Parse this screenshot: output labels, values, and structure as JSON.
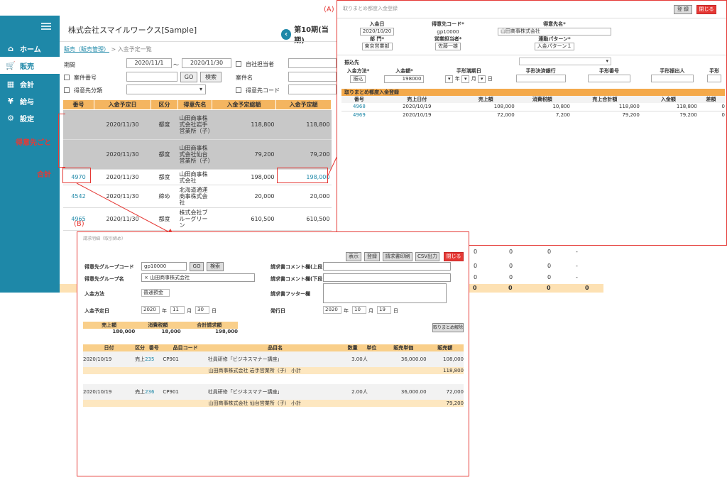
{
  "sidebar": {
    "items": [
      {
        "label": "ホーム"
      },
      {
        "label": "販売"
      },
      {
        "label": "会計"
      },
      {
        "label": "給与"
      },
      {
        "label": "設定"
      }
    ]
  },
  "header": {
    "company": "株式会社スマイルワークス[Sample]",
    "period": "第10期(当期)"
  },
  "breadcrumb": {
    "link": "販売（販売管理）",
    "current": "> 入金予定一覧"
  },
  "filters": {
    "period_label": "期間",
    "from": "2020/11/1",
    "tilde": "～",
    "to": "2020/11/30",
    "own_staff": "自社担当者",
    "case_no": "案件番号",
    "go": "GO",
    "search": "検索",
    "client_name": "案件名",
    "client_class": "得意先分類",
    "client_code": "得意先コード"
  },
  "table": {
    "headers": [
      "番号",
      "入金予定日",
      "区分",
      "得意先名",
      "入金予定総額",
      "入金予定額"
    ],
    "rows": [
      {
        "no": "",
        "date": "2020/11/30",
        "kind": "都度",
        "name": "山田商事株式会社岩手営業所（子）",
        "total": "118,800",
        "amount": "118,800"
      },
      {
        "no": "",
        "date": "2020/11/30",
        "kind": "都度",
        "name": "山田商事株式会社仙台営業所（子）",
        "total": "79,200",
        "amount": "79,200"
      },
      {
        "no": "4970",
        "date": "2020/11/30",
        "kind": "都度",
        "name": "山田商事株式会社",
        "total": "198,000",
        "amount": "198,000"
      },
      {
        "no": "4542",
        "date": "2020/11/30",
        "kind": "締め",
        "name": "北海道通運商事株式会社",
        "total": "20,000",
        "amount": "20,000"
      },
      {
        "no": "4965",
        "date": "2020/11/30",
        "kind": "都度",
        "name": "株式会社ブルーグリーン",
        "total": "610,500",
        "amount": "610,500"
      }
    ]
  },
  "annotations": {
    "per_client": "得意先ごと",
    "total": "合計",
    "A": "(A)",
    "B": "(B)"
  },
  "panelA": {
    "title": "取りまとめ都度入金登録",
    "register": "登 録",
    "close": "閉じる",
    "h1": [
      "入金日",
      "得意先コード*",
      "得意先名*"
    ],
    "v1": [
      "2020/10/20",
      "gp10000",
      "山田商事株式会社"
    ],
    "h2": [
      "部 門*",
      "営業担当者*",
      "連動パターン*"
    ],
    "v2": [
      "東京営業部",
      "佐藤一雄",
      "入金パターン１"
    ],
    "transfer": "振込先",
    "h3": [
      "入金方法*",
      "入金額*",
      "手形満期日",
      "手形決済銀行",
      "手形番号",
      "手形振出人",
      "手形"
    ],
    "method": "振込",
    "amount": "198000",
    "year": "年",
    "month": "月",
    "day": "日",
    "section": "取りまとめ都度入金登録",
    "h4": [
      "番号",
      "売上日付",
      "売上額",
      "消費税額",
      "売上合計額",
      "入金額",
      "差額"
    ],
    "rows": [
      [
        "4968",
        "2020/10/19",
        "108,000",
        "10,800",
        "118,800",
        "118,800",
        "0"
      ],
      [
        "4969",
        "2020/10/19",
        "72,000",
        "7,200",
        "79,200",
        "79,200",
        "0"
      ]
    ]
  },
  "panelB": {
    "title": "請求明細（取引締め）",
    "buttons": [
      "表示",
      "登録",
      "請求書印刷",
      "CSV出力"
    ],
    "close": "閉じる",
    "grp_code_label": "得意先グループコード",
    "grp_code": "gp10000",
    "go": "GO",
    "search": "検索",
    "grp_name_label": "得意先グループ名",
    "grp_name": "× 山田商事株式会社",
    "method_label": "入金方法",
    "method": "普通預金",
    "date_label": "入金予定日",
    "year": "2020",
    "month": "11",
    "day": "30",
    "y": "年",
    "m": "月",
    "d": "日",
    "c_upper": "請求書コメント欄(上段)",
    "c_lower": "請求書コメント欄(下段)",
    "footer": "請求書フッター欄",
    "issue_label": "発行日",
    "iyear": "2020",
    "imonth": "10",
    "iday": "19",
    "sum_headers": [
      "売上額",
      "消費税額",
      "合計請求額"
    ],
    "sums": [
      "180,000",
      "18,000",
      "198,000"
    ],
    "cancel": "取りまとめ解除",
    "headers": [
      "日付",
      "区分",
      "番号",
      "品目コード",
      "品目名",
      "数量",
      "単位",
      "販売単価",
      "販売額"
    ],
    "lines": [
      {
        "date": "2020/10/19",
        "kind": "売上",
        "no": "235",
        "code": "CP901",
        "item": "社員研修「ビジネスマナー講座」",
        "qty": "3.00",
        "unit": "人",
        "price": "36,000.00",
        "amount": "108,000",
        "subtotal_label": "山田商事株式会社 岩手営業所（子） 小計",
        "subtotal": "118,800"
      },
      {
        "date": "2020/10/19",
        "kind": "売上",
        "no": "236",
        "code": "CP901",
        "item": "社員研修「ビジネスマナー講座」",
        "qty": "2.00",
        "unit": "人",
        "price": "36,000.00",
        "amount": "72,000",
        "subtotal_label": "山田商事株式会社 仙台営業所（子） 小計",
        "subtotal": "79,200"
      }
    ]
  },
  "behind": {
    "zero": "0",
    "dash": "-"
  }
}
